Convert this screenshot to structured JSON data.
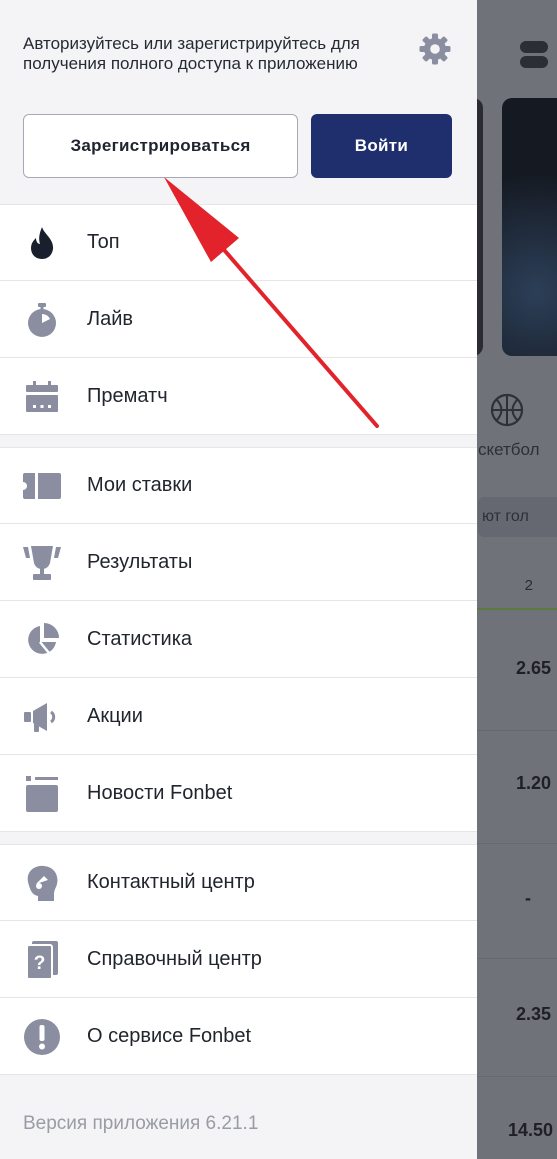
{
  "drawer": {
    "auth": {
      "prompt": "Авторизуйтесь или зарегистрируйтесь для получения полного доступа к приложению",
      "register_label": "Зарегистрироваться",
      "login_label": "Войти",
      "settings_icon": "gear-icon"
    },
    "menu_groups": [
      [
        {
          "label": "Топ",
          "icon": "flame-icon"
        },
        {
          "label": "Лайв",
          "icon": "stopwatch-icon"
        },
        {
          "label": "Прематч",
          "icon": "calendar-icon"
        }
      ],
      [
        {
          "label": "Мои ставки",
          "icon": "ticket-icon"
        },
        {
          "label": "Результаты",
          "icon": "trophy-icon"
        },
        {
          "label": "Статистика",
          "icon": "pie-chart-icon"
        },
        {
          "label": "Акции",
          "icon": "megaphone-icon"
        },
        {
          "label": "Новости Fonbet",
          "icon": "news-icon"
        }
      ],
      [
        {
          "label": "Контактный центр",
          "icon": "support-head-icon"
        },
        {
          "label": "Справочный центр",
          "icon": "help-book-icon"
        },
        {
          "label": "О сервисе Fonbet",
          "icon": "exclamation-icon"
        }
      ]
    ],
    "version": "Версия приложения 6.21.1"
  },
  "background_app": {
    "sport_label": "скетбол",
    "chip_label": "ют гол",
    "column_header": "2",
    "odds": [
      "2.65",
      "1.20",
      "-",
      "2.35",
      "14.50"
    ]
  },
  "colors": {
    "primary": "#1f2e6d",
    "icon": "#8a8ea0",
    "arrow": "#e3232b"
  }
}
